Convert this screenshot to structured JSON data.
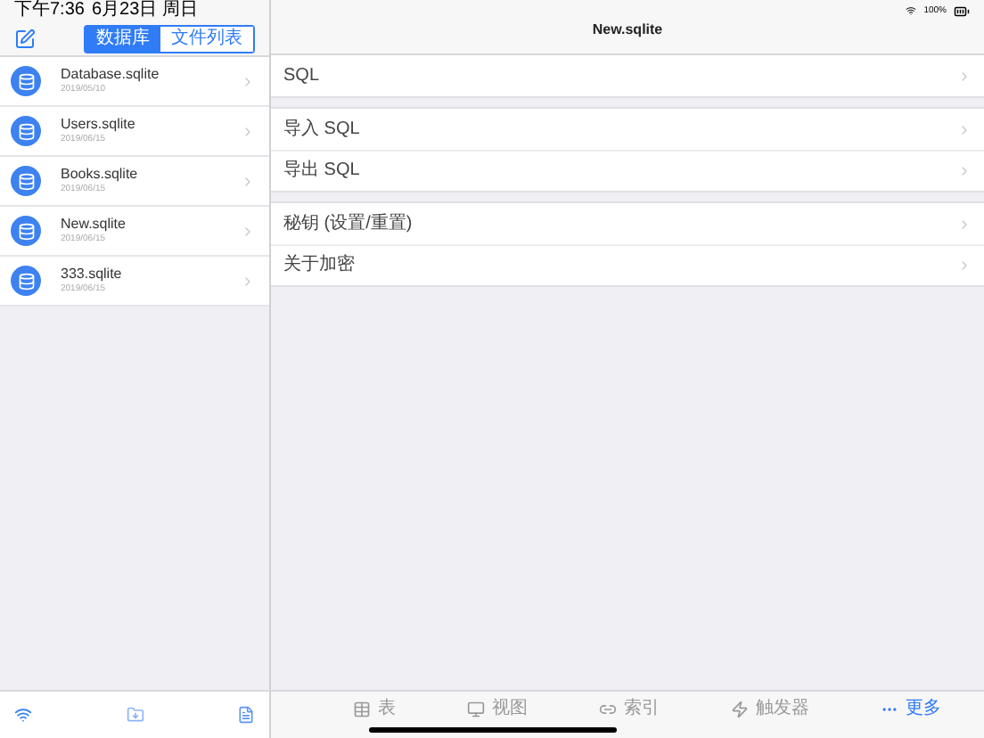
{
  "status_bar": {
    "time": "下午7:36",
    "date": "6月23日 周日",
    "battery": "100%"
  },
  "sidebar": {
    "segments": [
      {
        "label": "数据库",
        "selected": true
      },
      {
        "label": "文件列表",
        "selected": false
      }
    ],
    "items": [
      {
        "name": "Database.sqlite",
        "date": "2019/05/10"
      },
      {
        "name": "Users.sqlite",
        "date": "2019/06/15"
      },
      {
        "name": "Books.sqlite",
        "date": "2019/06/15"
      },
      {
        "name": "New.sqlite",
        "date": "2019/06/15"
      },
      {
        "name": "333.sqlite",
        "date": "2019/06/15"
      }
    ]
  },
  "detail": {
    "title": "New.sqlite",
    "groups": [
      [
        {
          "label": "SQL"
        }
      ],
      [
        {
          "label": "导入 SQL"
        },
        {
          "label": "导出 SQL"
        }
      ],
      [
        {
          "label": "秘钥 (设置/重置)"
        },
        {
          "label": "关于加密"
        }
      ]
    ]
  },
  "tab_bar": [
    {
      "kind": "table",
      "label": "表",
      "selected": false
    },
    {
      "kind": "view",
      "label": "视图",
      "selected": false
    },
    {
      "kind": "index",
      "label": "索引",
      "selected": false
    },
    {
      "kind": "trigger",
      "label": "触发器",
      "selected": false
    },
    {
      "kind": "more",
      "label": "更多",
      "selected": true
    }
  ]
}
